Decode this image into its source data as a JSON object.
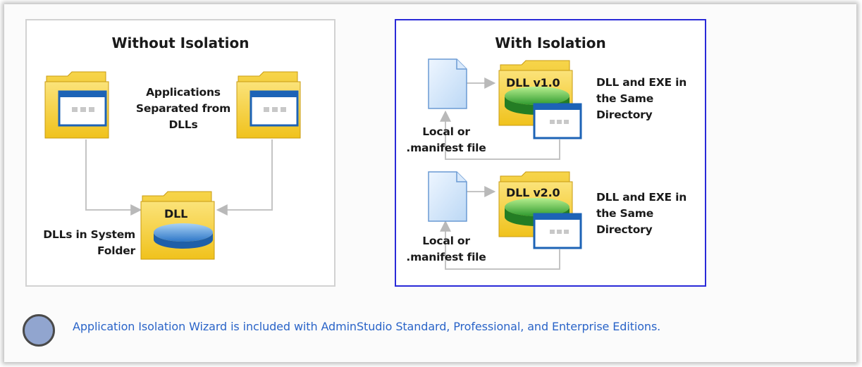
{
  "without_isolation": {
    "title": "Without Isolation",
    "applications_label": [
      "Applications",
      "Separated from",
      "DLLs"
    ],
    "system_folder_label": [
      "DLLs in System",
      "Folder"
    ],
    "dll_folder_label": "DLL"
  },
  "with_isolation": {
    "title": "With Isolation",
    "groups": [
      {
        "dll_label": "DLL v1.0",
        "description": [
          "DLL and EXE in",
          "the Same",
          "Directory"
        ],
        "manifest_label": [
          "Local or",
          ".manifest file"
        ]
      },
      {
        "dll_label": "DLL v2.0",
        "description": [
          "DLL and EXE in",
          "the Same",
          "Directory"
        ],
        "manifest_label": [
          "Local or",
          ".manifest file"
        ]
      }
    ]
  },
  "note": {
    "text": "Application Isolation Wizard is included with AdminStudio Standard, Professional, and Enterprise Editions."
  },
  "colors": {
    "folder": "#f3cf2b",
    "window_border": "#1d63b6",
    "disk": "#4a90d9",
    "disk_green": "#3aa83a",
    "right_panel_border": "#2a2ad8",
    "note_text": "#2a64c8"
  }
}
